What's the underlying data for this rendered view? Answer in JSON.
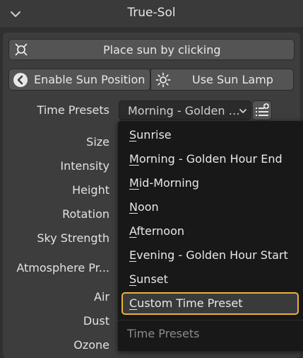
{
  "header": {
    "title": "True-Sol",
    "collapse_icon": "chevron-down-icon"
  },
  "buttons": {
    "place_sun": {
      "label": "Place sun by clicking",
      "icon": "sun-target-icon"
    },
    "enable_sun_position": {
      "label": "Enable Sun Position",
      "icon": "chevron-left-circle-icon"
    },
    "use_sun_lamp": {
      "label": "Use Sun Lamp",
      "icon": "sun-lamp-icon"
    }
  },
  "time_presets": {
    "label": "Time Presets",
    "selected": "Morning - Golden …",
    "add_icon": "list-add-icon"
  },
  "property_labels": [
    "Size",
    "Intensity",
    "Height",
    "Rotation",
    "Sky Strength",
    "Atmosphere Pr...",
    "Air",
    "Dust",
    "Ozone"
  ],
  "menu": {
    "items": [
      {
        "first": "S",
        "rest": "unrise"
      },
      {
        "first": "M",
        "rest": "orning - Golden Hour End"
      },
      {
        "first": "M",
        "rest": "id-Morning"
      },
      {
        "first": "N",
        "rest": "oon"
      },
      {
        "first": "A",
        "rest": "fternoon"
      },
      {
        "first": "E",
        "rest": "vening - Golden Hour Start"
      },
      {
        "first": "S",
        "rest": "unset"
      },
      {
        "first": "C",
        "rest": "ustom Time Preset"
      }
    ],
    "footer": "Time Presets",
    "highlight_color": "#e9b23a"
  }
}
